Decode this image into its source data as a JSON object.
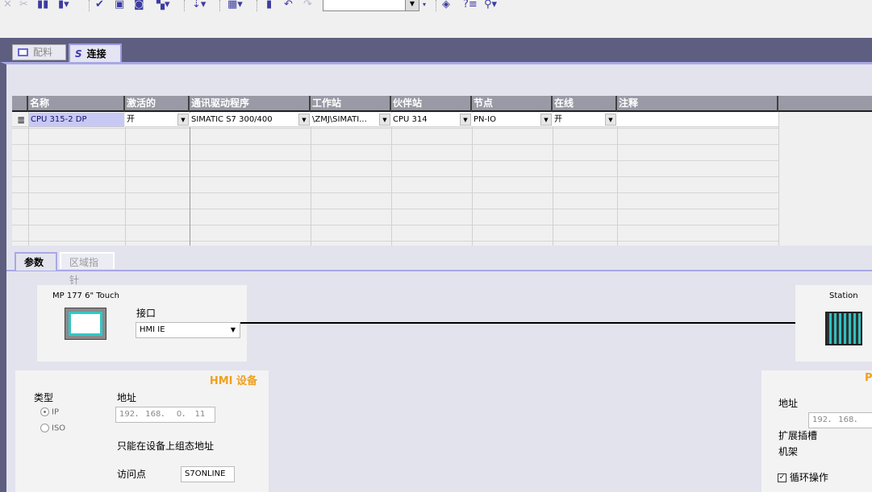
{
  "toolbar": {
    "icons": [
      "delete-icon",
      "cut-icon",
      "copy-icon",
      "paste-icon",
      "check-icon",
      "compile-icon",
      "glasses-icon",
      "network-icon",
      "download-icon",
      "layout-icon",
      "bookmark-icon",
      "undo-icon",
      "redo-icon",
      "book-icon",
      "help-list-icon",
      "zoom-icon"
    ],
    "combo_value": ""
  },
  "main_tabs": [
    {
      "label": "配料",
      "icon": "window-icon",
      "active": false
    },
    {
      "label": "连接",
      "icon": "connection-icon",
      "active": true
    }
  ],
  "grid": {
    "columns": [
      "名称",
      "激活的",
      "通讯驱动程序",
      "工作站",
      "伙伴站",
      "节点",
      "在线",
      "注释"
    ],
    "rows": [
      {
        "name": "CPU 315-2 DP",
        "active": "开",
        "driver": "SIMATIC S7 300/400",
        "station": "\\ZMJ\\SIMATI...",
        "partner": "CPU 314",
        "node": "PN-IO",
        "online": "开",
        "comment": ""
      }
    ]
  },
  "sub_tabs": [
    {
      "label": "参数",
      "active": true
    },
    {
      "label": "区域指针",
      "active": false
    }
  ],
  "hmi_device": {
    "name": "MP 177 6\" Touch",
    "interface_label": "接口",
    "interface_value": "HMI IE"
  },
  "station": {
    "name": "Station"
  },
  "hmi_settings": {
    "title": "HMI 设备",
    "type_label": "类型",
    "type_options": [
      {
        "label": "IP",
        "selected": true
      },
      {
        "label": "ISO",
        "selected": false
      }
    ],
    "address_label": "地址",
    "address_value": "192． 168．   0．  11",
    "note": "只能在设备上组态地址",
    "access_point_label": "访问点",
    "access_point_value": "S7ONLINE"
  },
  "plc_settings": {
    "title": "P",
    "address_label": "地址",
    "address_value": "192． 168．",
    "slot_label": "扩展插槽",
    "rack_label": "机架",
    "cyclic_label": "循环操作",
    "cyclic_checked": true
  },
  "colors": {
    "band": "#5e5e80",
    "accent": "#a8a8e8",
    "header": "#9a9aa6",
    "title_orange": "#f0a020"
  }
}
